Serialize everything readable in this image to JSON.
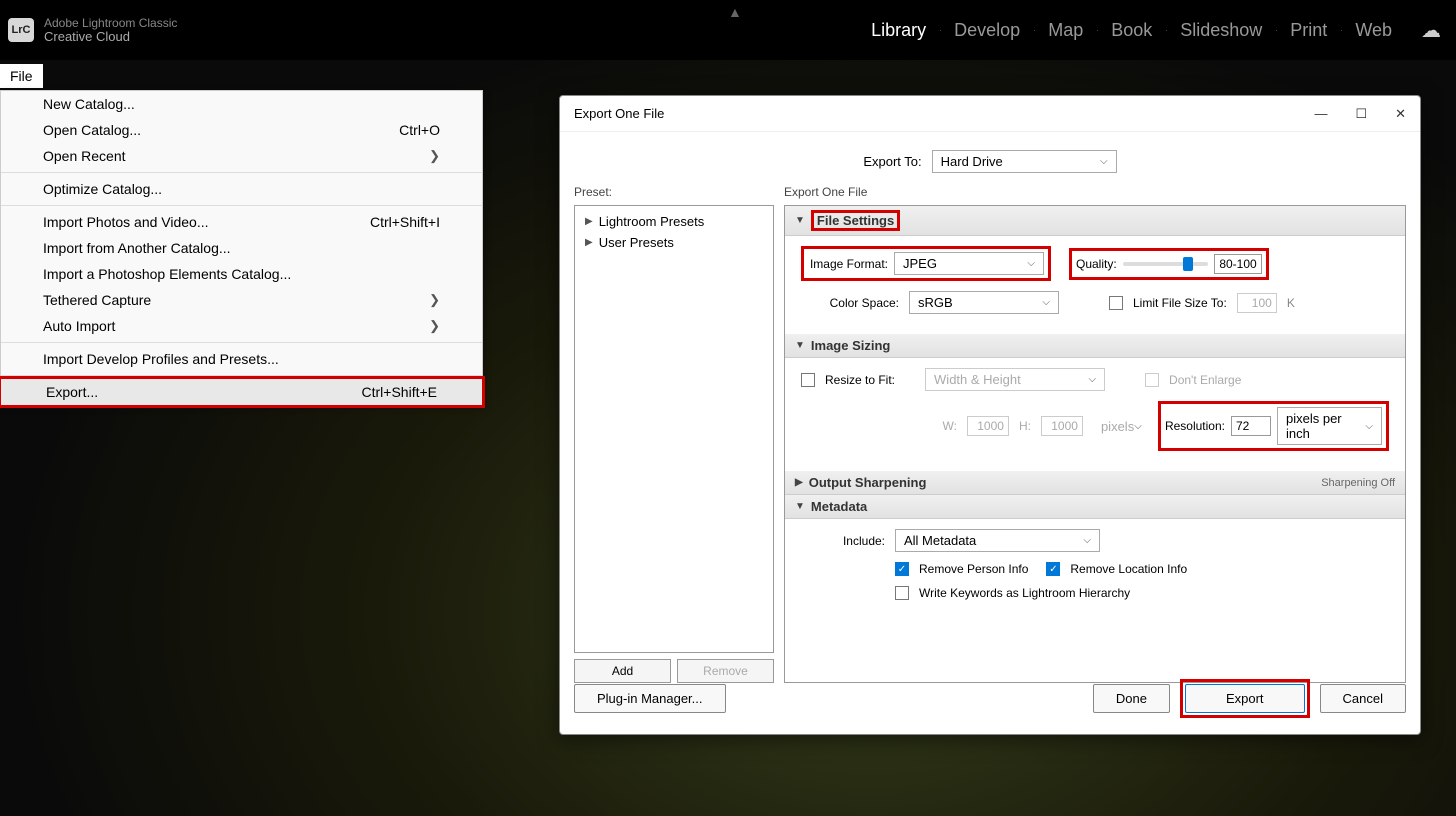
{
  "app": {
    "name": "Adobe Lightroom Classic",
    "subtitle": "Creative Cloud",
    "logo": "LrC"
  },
  "modules": [
    "Library",
    "Develop",
    "Map",
    "Book",
    "Slideshow",
    "Print",
    "Web"
  ],
  "active_module": "Library",
  "menubar": {
    "file": "File"
  },
  "file_menu": {
    "new_catalog": "New Catalog...",
    "open_catalog": "Open Catalog...",
    "open_catalog_sc": "Ctrl+O",
    "open_recent": "Open Recent",
    "optimize": "Optimize Catalog...",
    "import_photos": "Import Photos and Video...",
    "import_photos_sc": "Ctrl+Shift+I",
    "import_another": "Import from Another Catalog...",
    "import_pse": "Import a Photoshop Elements Catalog...",
    "tethered": "Tethered Capture",
    "auto_import": "Auto Import",
    "import_dev_profiles": "Import Develop Profiles and Presets...",
    "export": "Export...",
    "export_sc": "Ctrl+Shift+E"
  },
  "dialog": {
    "title": "Export One File",
    "export_to_label": "Export To:",
    "export_to_value": "Hard Drive",
    "preset_label": "Preset:",
    "presets": [
      "Lightroom Presets",
      "User Presets"
    ],
    "add_btn": "Add",
    "remove_btn": "Remove",
    "settings_label": "Export One File",
    "file_settings": {
      "header": "File Settings",
      "image_format_label": "Image Format:",
      "image_format_value": "JPEG",
      "quality_label": "Quality:",
      "quality_value": "80-100",
      "color_space_label": "Color Space:",
      "color_space_value": "sRGB",
      "limit_label": "Limit File Size To:",
      "limit_value": "100",
      "limit_unit": "K"
    },
    "image_sizing": {
      "header": "Image Sizing",
      "resize_label": "Resize to Fit:",
      "resize_value": "Width & Height",
      "dont_enlarge": "Don't Enlarge",
      "w_label": "W:",
      "w_value": "1000",
      "h_label": "H:",
      "h_value": "1000",
      "pixels": "pixels",
      "resolution_label": "Resolution:",
      "resolution_value": "72",
      "resolution_unit": "pixels per inch"
    },
    "output_sharpening": {
      "header": "Output Sharpening",
      "status": "Sharpening Off"
    },
    "metadata": {
      "header": "Metadata",
      "include_label": "Include:",
      "include_value": "All Metadata",
      "remove_person": "Remove Person Info",
      "remove_location": "Remove Location Info",
      "write_keywords": "Write Keywords as Lightroom Hierarchy"
    },
    "plugin_manager": "Plug-in Manager...",
    "done": "Done",
    "export_btn": "Export",
    "cancel": "Cancel"
  }
}
